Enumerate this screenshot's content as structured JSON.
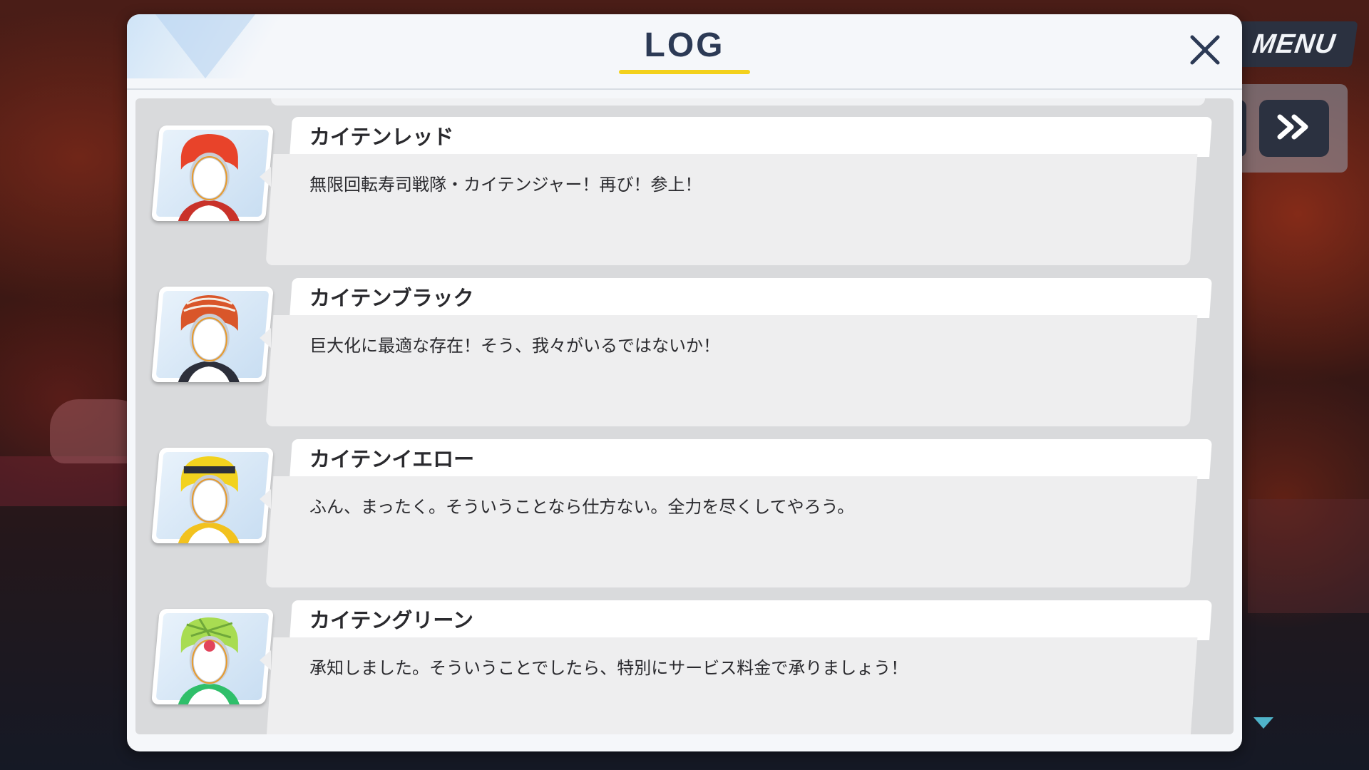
{
  "header": {
    "title": "LOG"
  },
  "game_controls": {
    "menu_label": "MENU"
  },
  "log_entries": [
    {
      "speaker": "カイテンレッド",
      "text": "無限回転寿司戦隊・カイテンジャー！再び！参上！",
      "helmet_color": "#e8432a",
      "accent_color": "#c9322a"
    },
    {
      "speaker": "カイテンブラック",
      "text": "巨大化に最適な存在！そう、我々がいるではないか！",
      "helmet_color": "#d9562a",
      "accent_color": "#2c2f3a"
    },
    {
      "speaker": "カイテンイエロー",
      "text": "ふん、まったく。そういうことなら仕方ない。全力を尽くしてやろう。",
      "helmet_color": "#f2d21e",
      "accent_color": "#f2c21e"
    },
    {
      "speaker": "カイテングリーン",
      "text": "承知しました。そういうことでしたら、特別にサービス料金で承りましょう！",
      "helmet_color": "#a8dc52",
      "accent_color": "#2fbf6a"
    }
  ],
  "colors": {
    "title_underline": "#f3d11d",
    "title_text": "#2c3a55",
    "scroll_indicator": "#4fb3c9"
  },
  "icons": {
    "close": "close-icon",
    "skip": "fast-forward-icon",
    "scroll": "chevron-down-icon"
  }
}
